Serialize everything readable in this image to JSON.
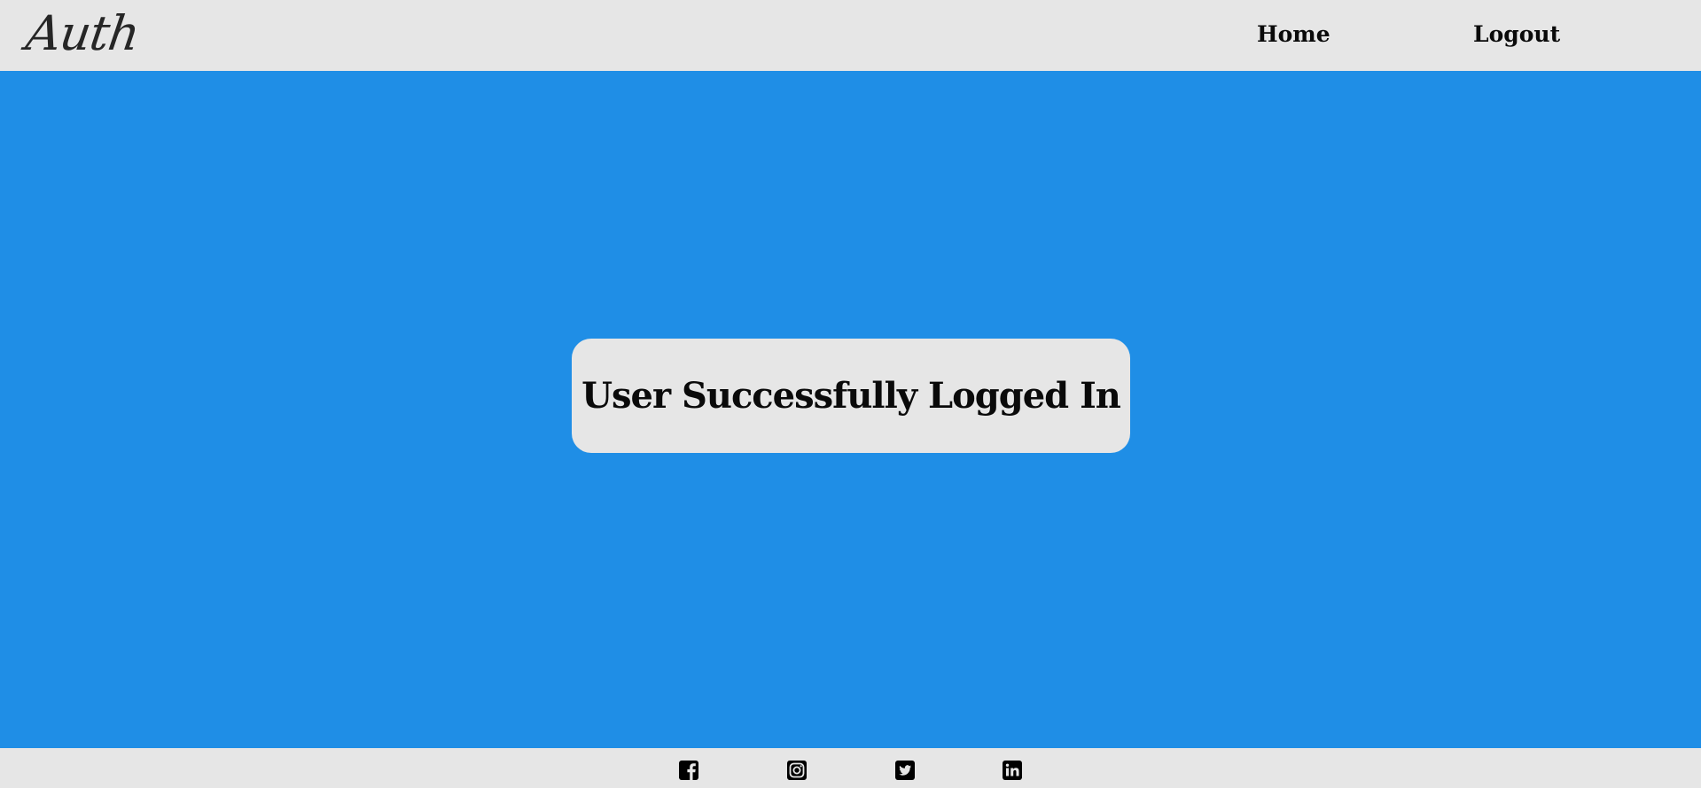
{
  "header": {
    "logo_text": "Auth",
    "nav": [
      {
        "label": "Home"
      },
      {
        "label": "Logout"
      }
    ]
  },
  "main": {
    "message": "User Successfully Logged In"
  },
  "footer": {
    "social_icons": [
      "facebook-icon",
      "instagram-icon",
      "twitter-icon",
      "linkedin-icon"
    ]
  },
  "colors": {
    "navbar_bg": "#e6e6e6",
    "main_bg": "#1f8ee6",
    "card_bg": "#e6e6e6",
    "text": "#0a0a0a"
  }
}
